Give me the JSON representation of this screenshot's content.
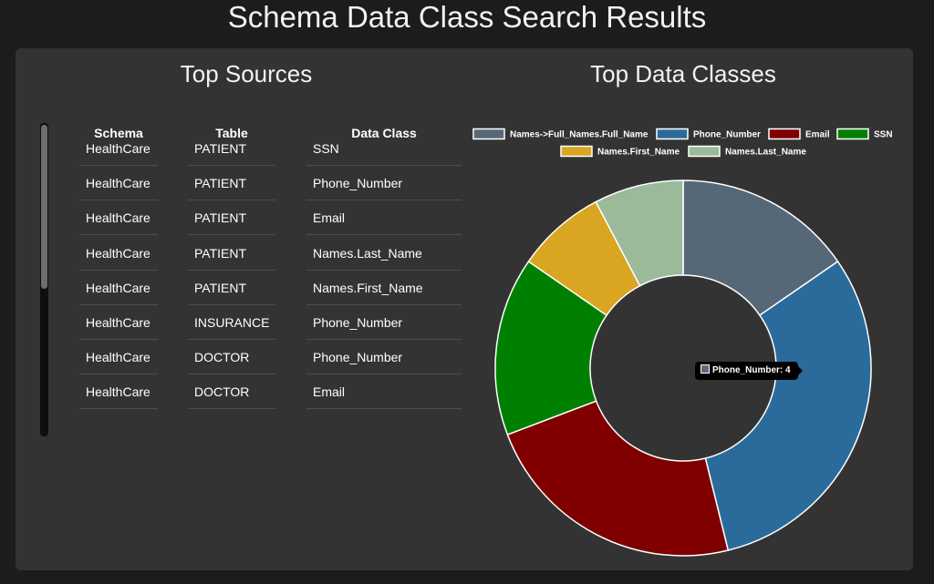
{
  "page": {
    "title": "Schema Data Class Search Results"
  },
  "sources": {
    "title": "Top Sources",
    "columns": [
      "Schema",
      "Table",
      "Data Class"
    ],
    "rows": [
      [
        "HealthCare",
        "PATIENT",
        "SSN"
      ],
      [
        "HealthCare",
        "PATIENT",
        "Phone_Number"
      ],
      [
        "HealthCare",
        "PATIENT",
        "Email"
      ],
      [
        "HealthCare",
        "PATIENT",
        "Names.Last_Name"
      ],
      [
        "HealthCare",
        "PATIENT",
        "Names.First_Name"
      ],
      [
        "HealthCare",
        "INSURANCE",
        "Phone_Number"
      ],
      [
        "HealthCare",
        "DOCTOR",
        "Phone_Number"
      ],
      [
        "HealthCare",
        "DOCTOR",
        "Email"
      ]
    ]
  },
  "classes": {
    "title": "Top Data Classes",
    "tooltip": {
      "label": "Phone_Number: 4",
      "color": "#5a6b7d"
    }
  },
  "chart_data": {
    "type": "pie",
    "donut": true,
    "legend_position": "top",
    "categories": [
      "Names->Full_Names.Full_Name",
      "Phone_Number",
      "Email",
      "SSN",
      "Names.First_Name",
      "Names.Last_Name"
    ],
    "values": [
      2,
      4,
      3,
      2,
      1,
      1
    ],
    "colors": [
      "#566778",
      "#2a6b9b",
      "#800000",
      "#008000",
      "#daa520",
      "#9aba9a"
    ]
  }
}
